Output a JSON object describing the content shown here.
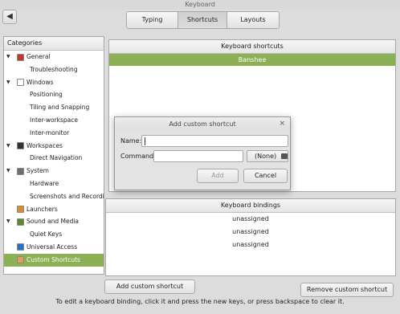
{
  "window": {
    "title": "Keyboard"
  },
  "tabs": [
    {
      "label": "Typing"
    },
    {
      "label": "Shortcuts"
    },
    {
      "label": "Layouts"
    }
  ],
  "categories": {
    "header": "Categories",
    "items": [
      {
        "label": "General",
        "level": 0,
        "icon": "general-icon",
        "color": "#c0392b"
      },
      {
        "label": "Troubleshooting",
        "level": 1
      },
      {
        "label": "Windows",
        "level": 0,
        "icon": "windows-icon",
        "color": "#ffffff"
      },
      {
        "label": "Positioning",
        "level": 1
      },
      {
        "label": "Tiling and Snapping",
        "level": 1
      },
      {
        "label": "Inter-workspace",
        "level": 1
      },
      {
        "label": "Inter-monitor",
        "level": 1
      },
      {
        "label": "Workspaces",
        "level": 0,
        "icon": "workspaces-icon",
        "color": "#333333"
      },
      {
        "label": "Direct Navigation",
        "level": 1
      },
      {
        "label": "System",
        "level": 0,
        "icon": "system-icon",
        "color": "#6d6d6d"
      },
      {
        "label": "Hardware",
        "level": 1
      },
      {
        "label": "Screenshots and Recording",
        "level": 1
      },
      {
        "label": "Launchers",
        "level": 0,
        "icon": "launchers-icon",
        "color": "#e08a2c"
      },
      {
        "label": "Sound and Media",
        "level": 0,
        "icon": "sound-media-icon",
        "color": "#5a8a2a"
      },
      {
        "label": "Quiet Keys",
        "level": 1
      },
      {
        "label": "Universal Access",
        "level": 0,
        "icon": "universal-access-icon",
        "color": "#2a6fc9"
      },
      {
        "label": "Custom Shortcuts",
        "level": 0,
        "icon": "custom-shortcuts-icon",
        "color": "#d9a15a",
        "selected": true
      }
    ]
  },
  "shortcuts": {
    "header": "Keyboard shortcuts",
    "items": [
      "Banshee"
    ]
  },
  "bindings": {
    "header": "Keyboard bindings",
    "items": [
      "unassigned",
      "unassigned",
      "unassigned"
    ]
  },
  "buttons": {
    "add_custom": "Add custom shortcut",
    "remove_custom": "Remove custom shortcut"
  },
  "hint": "To edit a keyboard binding, click it and press the new keys, or press backspace to clear it.",
  "dialog": {
    "title": "Add custom shortcut",
    "close": "×",
    "name_label": "Name:",
    "name_value": "",
    "command_label": "Command:",
    "command_value": "",
    "file_chooser_label": "(None)",
    "add_button": "Add",
    "cancel_button": "Cancel"
  },
  "colors": {
    "accent": "#8bb055"
  }
}
